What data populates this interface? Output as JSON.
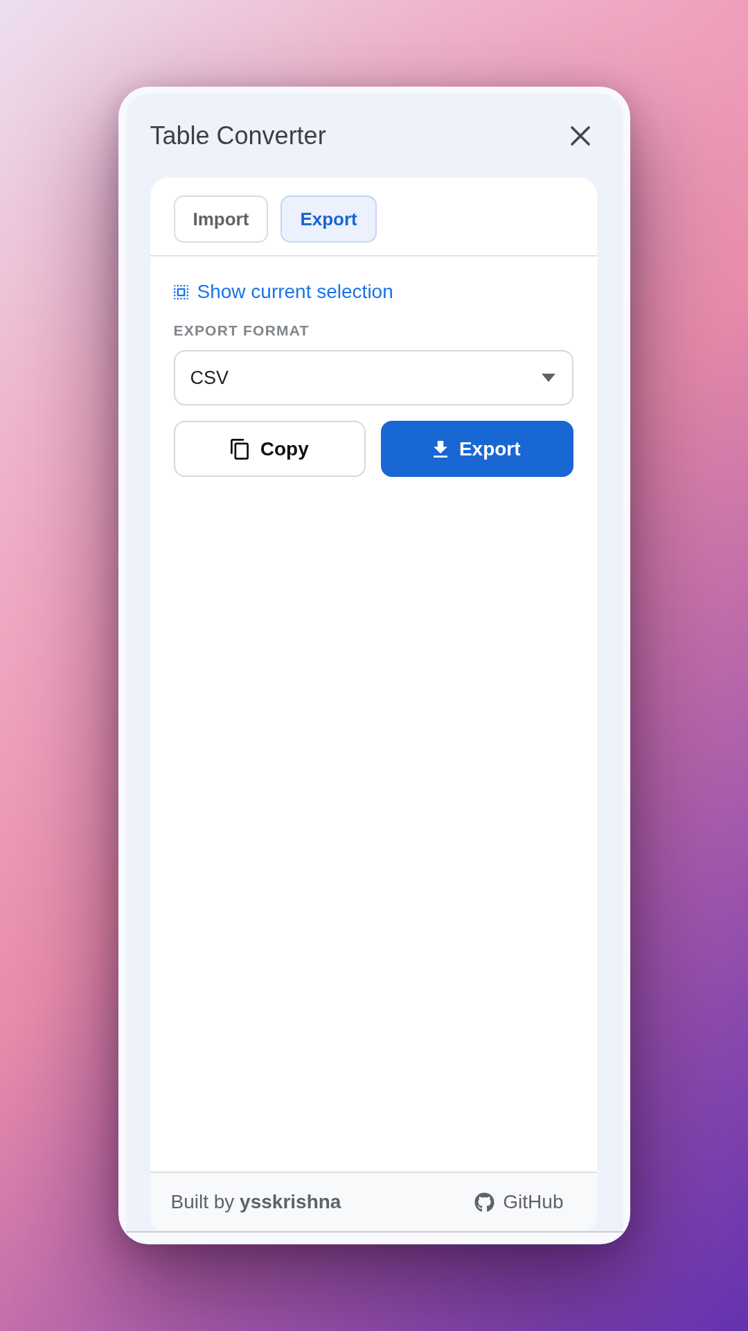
{
  "window": {
    "title": "Table Converter"
  },
  "tabs": [
    {
      "label": "Import",
      "selected": false
    },
    {
      "label": "Export",
      "selected": true
    }
  ],
  "selection_link": {
    "label": "Show current selection"
  },
  "export_format": {
    "label": "EXPORT FORMAT",
    "value": "CSV"
  },
  "buttons": {
    "copy": {
      "label": "Copy"
    },
    "export": {
      "label": "Export"
    }
  },
  "footer": {
    "credit": "Built by **ysskrishna**",
    "link": "GitHub"
  }
}
